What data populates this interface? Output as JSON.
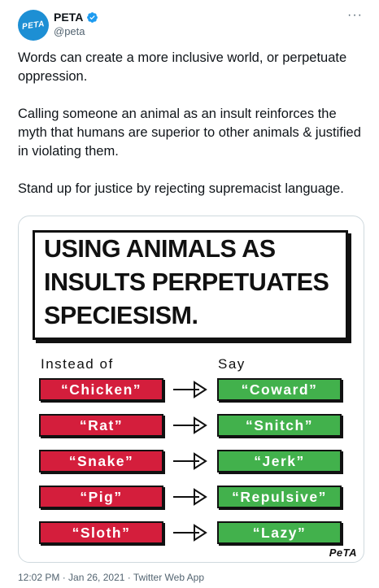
{
  "author": {
    "display_name": "PETA",
    "handle": "@peta",
    "avatar_text": "PETA"
  },
  "tweet": {
    "paragraphs": [
      "Words can create a more inclusive world, or perpetuate oppression.",
      "Calling someone an animal as an insult reinforces the myth that humans are superior to other animals & justified in violating them.",
      "Stand up for justice by rejecting supremacist language."
    ]
  },
  "image": {
    "headline": [
      "USING ANIMALS AS",
      "INSULTS PERPETUATES",
      "SPECIESISM."
    ],
    "instead_label": "Instead of",
    "say_label": "Say",
    "pairs": [
      {
        "instead": "“Chicken”",
        "say": "“Coward”"
      },
      {
        "instead": "“Rat”",
        "say": "“Snitch”"
      },
      {
        "instead": "“Snake”",
        "say": "“Jerk”"
      },
      {
        "instead": "“Pig”",
        "say": "“Repulsive”"
      },
      {
        "instead": "“Sloth”",
        "say": "“Lazy”"
      }
    ],
    "brand_mark": "PeTA"
  },
  "footer": {
    "meta": "12:02 PM · Jan 26, 2021 · Twitter Web App"
  },
  "colors": {
    "avatar": "#1d8fd4",
    "verified": "#1d9bf0",
    "red_pill": "#d41e3c",
    "green_pill": "#42b14c"
  },
  "icons": {
    "verified": "verified-badge-icon",
    "more": "more-options-icon",
    "arrow": "right-arrow-icon"
  }
}
